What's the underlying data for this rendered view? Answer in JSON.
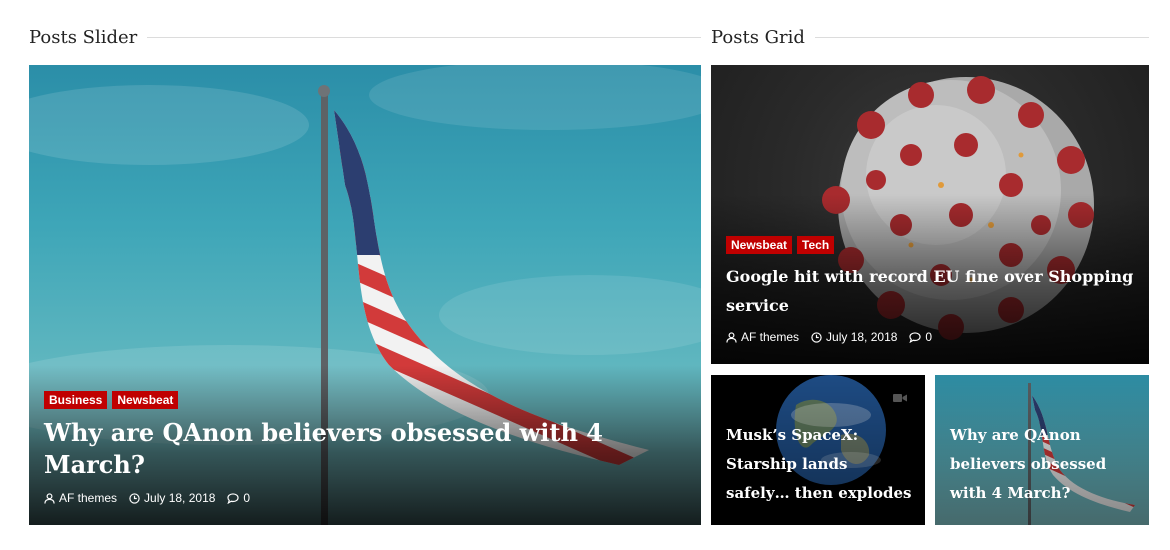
{
  "sections": {
    "slider_title": "Posts Slider",
    "grid_title": "Posts Grid"
  },
  "slider": {
    "categories": [
      "Business",
      "Newsbeat"
    ],
    "title": "Why are QAnon believers obsessed with 4 March?",
    "author": "AF themes",
    "date": "July 18, 2018",
    "comments": "0"
  },
  "grid": {
    "main": {
      "categories": [
        "Newsbeat",
        "Tech"
      ],
      "title": "Google hit with record EU fine over Shopping service",
      "author": "AF themes",
      "date": "July 18, 2018",
      "comments": "0"
    },
    "small": [
      {
        "title": "Musk’s SpaceX: Starship lands safely… then explodes",
        "icon": "video-camera-icon"
      },
      {
        "title": "Why are QAnon believers obsessed with 4 March?"
      }
    ]
  },
  "colors": {
    "category_badge": "#c00000",
    "heading_line": "#dcdcdc"
  },
  "icons": {
    "author": "user-icon",
    "date": "clock-icon",
    "comments": "comment-icon"
  }
}
